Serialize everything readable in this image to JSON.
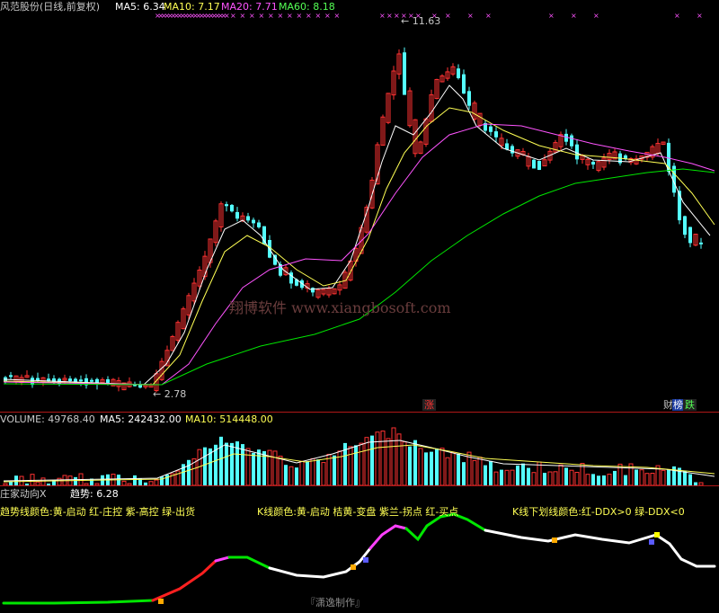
{
  "main_panel": {
    "stock_title": "风范股份(日线,前复权)",
    "ma5": "MA5: 6.34",
    "ma10": "MA10: 7.17",
    "ma20": "MA20: 7.71",
    "ma60": "MA60: 8.18",
    "high_label": "11.63",
    "low_label": "2.78",
    "watermark": "翔博软件 www.xiangbosoft.com",
    "badge_zhang": "涨",
    "badge_bang": "榜",
    "badge_die": "跌",
    "badge_cai": "财",
    "colors": {
      "up": "#ff3232",
      "down": "#54ffff",
      "ma5": "#ffffff",
      "ma10": "#ffff54",
      "ma20": "#ff54ff",
      "ma60": "#00e600"
    }
  },
  "volume_panel": {
    "volume": "VOLUME: 49768.40",
    "ma5": "MA5: 242432.00",
    "ma10": "MA10: 514448.00"
  },
  "indicator_panel": {
    "name": "庄家动向X",
    "trend": "趋势: 6.28",
    "legend_trend": "趋势线颜色:黄-启动 红-庄控 紫-高控 绿-出货",
    "legend_k": "K线颜色:黄-启动 桔黄-变盘 紫兰-拐点 红-买点",
    "legend_under": "K线下划线颜色:红-DDX>0 绿-DDX<0",
    "credit": "『潇逸制作』"
  }
}
